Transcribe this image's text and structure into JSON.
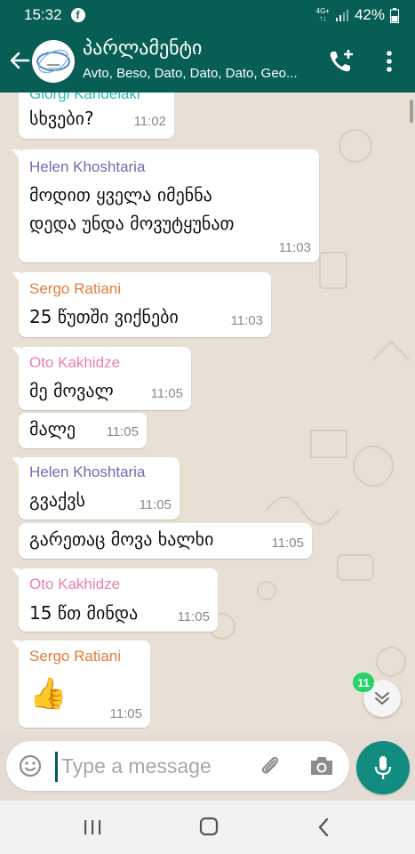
{
  "status_bar": {
    "time": "15:32",
    "facebook_glyph": "f",
    "network_top": "4G+",
    "network_bottom": "↑↓",
    "battery": "42%"
  },
  "header": {
    "title": "პარლამენტი",
    "subtitle": "Avto, Beso, Dato, Dato, Dato, Geo..."
  },
  "messages": [
    {
      "sender": "Giorgi Kandelaki",
      "sender_color": "#35b9b0",
      "lines": [
        "სხვები?"
      ],
      "time": "11:02"
    },
    {
      "sender": "Helen Khoshtaria",
      "sender_color": "#7b66b3",
      "lines": [
        "მოდით ყველა იმენნა",
        "დედა უნდა მოვუტყუნათ"
      ],
      "time": "11:03"
    },
    {
      "sender": "Sergo Ratiani",
      "sender_color": "#e07b39",
      "lines": [
        "25 წუთში ვიქნები"
      ],
      "time": "11:03"
    },
    {
      "sender": "Oto Kakhidze",
      "sender_color": "#e87fb0",
      "lines": [
        "მე მოვალ"
      ],
      "time": "11:05"
    },
    {
      "sender": "",
      "sender_color": "",
      "lines": [
        "მალე"
      ],
      "time": "11:05"
    },
    {
      "sender": "Helen Khoshtaria",
      "sender_color": "#7b66b3",
      "lines": [
        "გვაქვს"
      ],
      "time": "11:05"
    },
    {
      "sender": "",
      "sender_color": "",
      "lines": [
        "გარეთაც მოვა ხალხი"
      ],
      "time": "11:05"
    },
    {
      "sender": "Oto Kakhidze",
      "sender_color": "#e87fb0",
      "lines": [
        "15 წთ მინდა"
      ],
      "time": "11:05"
    },
    {
      "sender": "Sergo Ratiani",
      "sender_color": "#e07b39",
      "lines": [
        "👍"
      ],
      "time": "11:05"
    }
  ],
  "unread_badge": "11",
  "composer": {
    "placeholder": "Type a message"
  },
  "icons": {
    "back": "arrow-left-icon",
    "add_call": "add-call-icon",
    "menu": "kebab-menu-icon",
    "emoji": "emoji-icon",
    "attach": "paperclip-icon",
    "camera": "camera-icon",
    "mic": "microphone-icon"
  },
  "colors": {
    "header": "#075e54",
    "accent": "#128c7e",
    "badge": "#25d366",
    "chat_bg": "#e5ddd5"
  }
}
